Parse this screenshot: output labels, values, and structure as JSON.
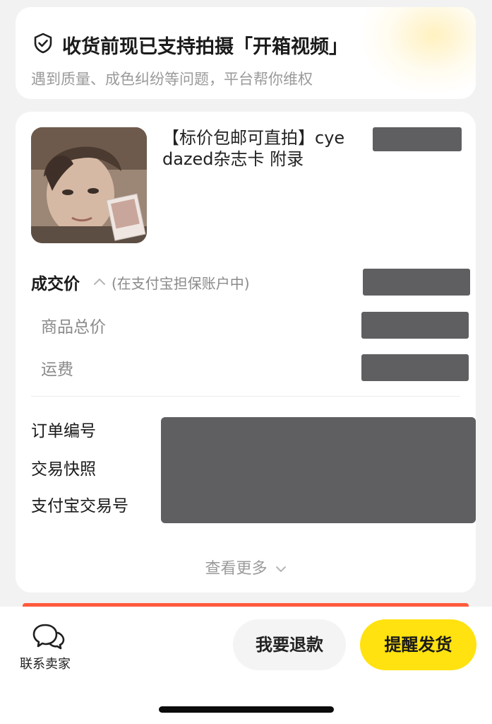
{
  "banner": {
    "title": "收货前现已支持拍摄「开箱视频」",
    "subtitle": "遇到质量、成色纠纷等问题，平台帮你维权",
    "icon": "shield-check-icon"
  },
  "order": {
    "item_title": "【标价包邮可直拍】cye dazed杂志卡 附录",
    "deal_price_label": "成交价",
    "deal_price_note": "(在支付宝担保账户中)",
    "goods_total_label": "商品总价",
    "shipping_label": "运费",
    "order_number_label": "订单编号",
    "snapshot_label": "交易快照",
    "alipay_trade_label": "支付宝交易号",
    "view_more": "查看更多"
  },
  "bottom": {
    "contact_seller": "联系卖家",
    "refund_button": "我要退款",
    "remind_ship_button": "提醒发货"
  },
  "colors": {
    "accent_yellow": "#ffe20f",
    "redaction_gray": "#5f5f62",
    "promo_red": "#ff5a3c"
  }
}
